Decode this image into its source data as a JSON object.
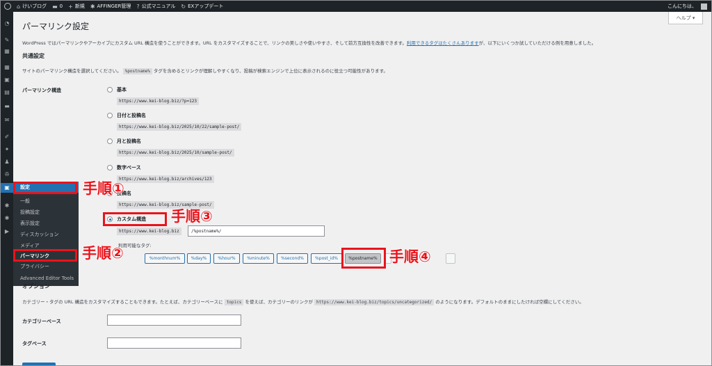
{
  "adminbar": {
    "site_name": "けいブログ",
    "comments_count": "0",
    "new_label": "新規",
    "affinger_label": "AFFINGER管理",
    "manual_label": "公式マニュアル",
    "ex_label": "EXアップデート",
    "greeting": "こんにちは、"
  },
  "help": {
    "label": "ヘルプ ▾"
  },
  "sidebar_menu": {
    "settings": "設定",
    "general": "一般",
    "writing": "投稿設定",
    "reading": "表示設定",
    "discussion": "ディスカッション",
    "media": "メディア",
    "permalink": "パーマリンク",
    "privacy": "プライバシー",
    "advanced_editor": "Advanced Editor Tools"
  },
  "main": {
    "title": "パーマリンク設定",
    "intro_before": "WordPress ではパーマリンクやアーカイブにカスタム URL 構造を使うことができます。URL をカスタマイズすることで、リンクの美しさや使いやすさ、そして前方互換性を改善できます。",
    "intro_link": "利用できるタグはたくさんあります",
    "intro_after": "が、以下にいくつか試していただける例を用意しました。",
    "common_title": "共通設定",
    "common_desc_before": "サイトのパーマリンク構造を選択してください。",
    "common_desc_code": "%postname%",
    "common_desc_after": "タグを含めるとリンクが理解しやすくなり、投稿が検索エンジンで上位に表示されるのに役立つ可能性があります。",
    "structure_label": "パーマリンク構造",
    "options": [
      {
        "label": "基本",
        "example": "https://www.kei-blog.biz/?p=123"
      },
      {
        "label": "日付と投稿名",
        "example": "https://www.kei-blog.biz/2025/10/22/sample-post/"
      },
      {
        "label": "月と投稿名",
        "example": "https://www.kei-blog.biz/2025/10/sample-post/"
      },
      {
        "label": "数字ベース",
        "example": "https://www.kei-blog.biz/archives/123"
      },
      {
        "label": "投稿名",
        "example": "https://www.kei-blog.biz/sample-post/"
      }
    ],
    "custom_label": "カスタム構造",
    "custom_prefix": "https://www.kei-blog.biz",
    "custom_value": "/%postname%/",
    "tags_label": "利用可能なタグ:",
    "tags": [
      "%monthnum%",
      "%day%",
      "%hour%",
      "%minute%",
      "%second%",
      "%post_id%",
      "%postname%"
    ],
    "optional_title": "オプション",
    "optional_before": "カテゴリー・タグの URL 構造をカスタマイズすることもできます。たとえば、カテゴリーベースに",
    "optional_code1": "topics",
    "optional_mid": "を使えば、カテゴリーのリンクが",
    "optional_code2": "https://www.kei-blog.biz/topics/uncategorized/",
    "optional_after": "のようになります。デフォルトのままにしたければ空欄にしてください。",
    "category_base_label": "カテゴリーベース",
    "tag_base_label": "タグベース"
  },
  "annotations": {
    "step1": "手順①",
    "step2": "手順②",
    "step3": "手順③",
    "step4": "手順④",
    "color": "#e8141c"
  }
}
